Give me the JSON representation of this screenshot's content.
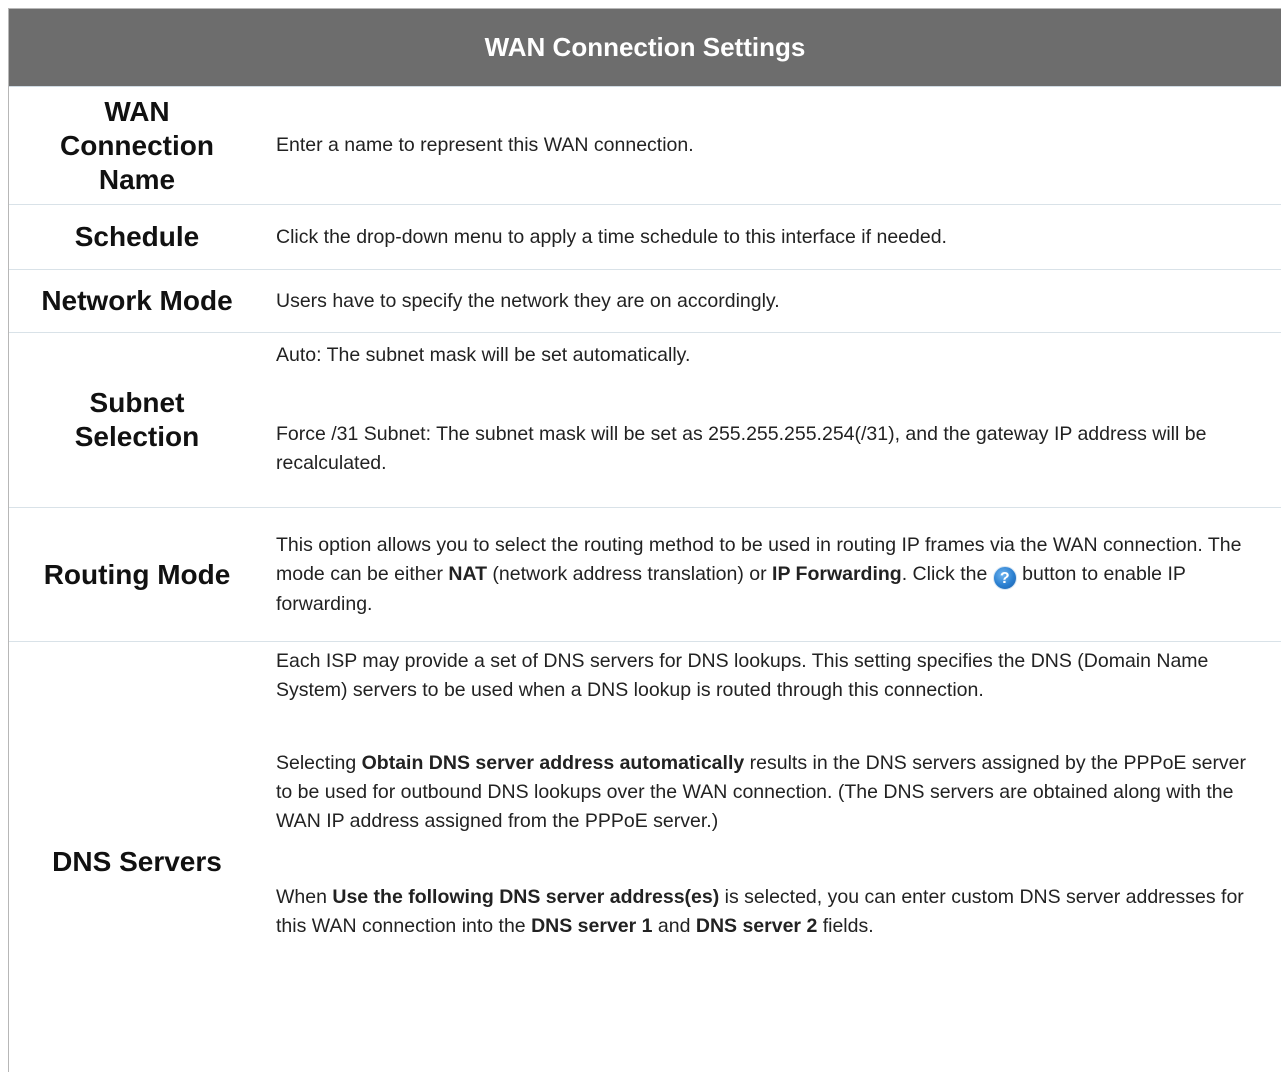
{
  "title": "WAN Connection Settings",
  "rows": {
    "name": {
      "label": "WAN Connection Name",
      "desc": "Enter a name to represent this WAN connection."
    },
    "schedule": {
      "label": "Schedule",
      "desc": "Click the drop-down menu to apply a time schedule to this interface if needed."
    },
    "network_mode": {
      "label": "Network Mode",
      "desc": "Users have to specify the network they are on accordingly."
    },
    "subnet": {
      "label": "Subnet Selection",
      "p1": "Auto: The subnet mask will be set automatically.",
      "p2": "Force /31 Subnet: The subnet mask will be set as 255.255.255.254(/31), and the gateway IP address will be recalculated."
    },
    "routing": {
      "label": "Routing Mode",
      "t1": "This option allows you to select the routing method to be used in routing IP frames via the WAN connection. The mode can be either ",
      "b1": "NAT",
      "t2": " (network address translation) or ",
      "b2": "IP Forwarding",
      "t3": ". Click the ",
      "icon": "help-icon",
      "icon_glyph": "?",
      "t4": " button to enable IP forwarding."
    },
    "dns": {
      "label": "DNS Servers",
      "p1": "Each ISP may provide a set of DNS servers for DNS lookups. This setting specifies the DNS (Domain Name System) servers to be used when a DNS lookup is routed through this connection.",
      "p2_t1": "Selecting ",
      "p2_b1": "Obtain DNS server address automatically",
      "p2_t2": " results in the DNS servers assigned by the PPPoE server to be used for outbound DNS lookups over the WAN connection. (The DNS servers are obtained along with the WAN IP address assigned from the PPPoE server.)",
      "p3_t1": "When ",
      "p3_b1": "Use the following DNS server address(es)",
      "p3_t2": " is selected, you can enter custom DNS server addresses for this WAN connection into the ",
      "p3_b2": "DNS server 1",
      "p3_t3": " and ",
      "p3_b3": "DNS server 2",
      "p3_t4": " fields."
    }
  },
  "colors": {
    "header_bg": "#6d6d6d",
    "header_text": "#ffffff",
    "row_divider": "#d9e2e8"
  }
}
